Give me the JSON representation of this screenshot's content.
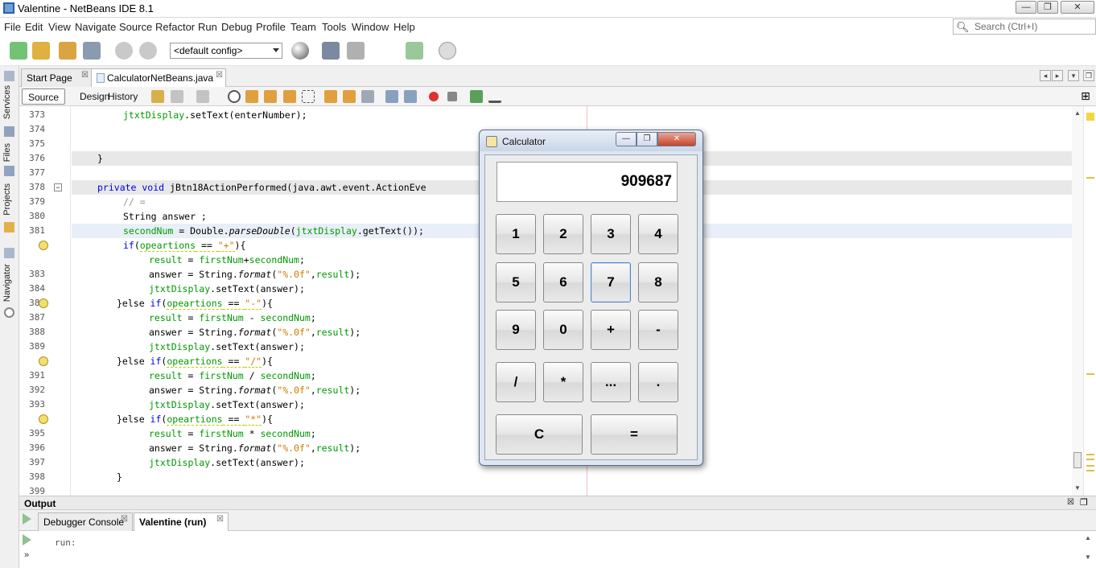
{
  "window": {
    "title": "Valentine - NetBeans IDE 8.1",
    "controls": [
      "—",
      "❐",
      "✕"
    ]
  },
  "menu": [
    "File",
    "Edit",
    "View",
    "Navigate",
    "Source",
    "Refactor",
    "Run",
    "Debug",
    "Profile",
    "Team",
    "Tools",
    "Window",
    "Help"
  ],
  "search": {
    "placeholder": "Search (Ctrl+I)"
  },
  "toolbar": {
    "config": "<default config>"
  },
  "side_tabs": [
    "Services",
    "Files",
    "Projects",
    "Navigator"
  ],
  "editor_tabs": [
    {
      "label": "Start Page"
    },
    {
      "label": "CalculatorNetBeans.java"
    }
  ],
  "editor_toolbar": {
    "source": "Source",
    "design": "Design",
    "history": "History"
  },
  "gutter": {
    "lines": [
      "373",
      "374",
      "375",
      "376",
      "377",
      "378",
      "379",
      "380",
      "381",
      "",
      "383",
      "384",
      "385",
      "",
      "387",
      "388",
      "389",
      "",
      "391",
      "392",
      "393",
      "",
      "395",
      "396",
      "397",
      "398",
      "399"
    ]
  },
  "code": {
    "l373": "jtxtDisplay",
    "l373b": ".setText(enterNumber);",
    "l376": "}",
    "l378a": "private void",
    "l378b": " jBtn18ActionPerformed(java.awt.event.ActionEve",
    "l379": "// =",
    "l380": "String answer ;",
    "l381a": "secondNum",
    "l381b": " = Double.",
    "l381c": "parseDouble",
    "l381d": "(",
    "l381e": "jtxtDisplay",
    "l381f": ".getText());",
    "l382a": "if",
    "l382b": "(",
    "l382c": "opeartions",
    "l382d": " == ",
    "l382e": "\"+\"",
    "l382f": "){",
    "l383a": "result",
    "l383b": " = ",
    "l383c": "firstNum",
    "l383d": "+",
    "l383e": "secondNum",
    "l383f": ";",
    "l384a": "answer = String.",
    "l384b": "format",
    "l384c": "(",
    "l384d": "\"%.0f\"",
    "l384e": ",",
    "l384f": "result",
    "l384g": ");",
    "l385a": "jtxtDisplay",
    "l385b": ".setText(answer);",
    "l386a": "}else ",
    "l386b": "if",
    "l386c": "(",
    "l386d": "opeartions",
    "l386e": " == ",
    "l386f": "\"-\"",
    "l386g": "){",
    "l387a": "result",
    "l387b": " = ",
    "l387c": "firstNum",
    "l387d": " - ",
    "l387e": "secondNum",
    "l387f": ";",
    "l388a": "answer = String.",
    "l388b": "format",
    "l388c": "(",
    "l388d": "\"%.0f\"",
    "l388e": ",",
    "l388f": "result",
    "l388g": ");",
    "l389a": "jtxtDisplay",
    "l389b": ".setText(answer);",
    "l390a": "}else ",
    "l390b": "if",
    "l390c": "(",
    "l390d": "opeartions",
    "l390e": " == ",
    "l390f": "\"/\"",
    "l390g": "){",
    "l391a": "result",
    "l391b": " = ",
    "l391c": "firstNum",
    "l391d": " / ",
    "l391e": "secondNum",
    "l391f": ";",
    "l392a": "answer = String.",
    "l392b": "format",
    "l392c": "(",
    "l392d": "\"%.0f\"",
    "l392e": ",",
    "l392f": "result",
    "l392g": ");",
    "l393a": "jtxtDisplay",
    "l393b": ".setText(answer);",
    "l394a": "}else ",
    "l394b": "if",
    "l394c": "(",
    "l394d": "opeartions",
    "l394e": " == ",
    "l394f": "\"*\"",
    "l394g": "){",
    "l395a": "result",
    "l395b": " = ",
    "l395c": "firstNum",
    "l395d": " * ",
    "l395e": "secondNum",
    "l395f": ";",
    "l396a": "answer = String.",
    "l396b": "format",
    "l396c": "(",
    "l396d": "\"%.0f\"",
    "l396e": ",",
    "l396f": "result",
    "l396g": ");",
    "l397a": "jtxtDisplay",
    "l397b": ".setText(answer);",
    "l398": "}"
  },
  "output": {
    "title": "Output",
    "tabs": [
      {
        "label": "Debugger Console"
      },
      {
        "label": "Valentine (run)"
      }
    ],
    "text": "run:"
  },
  "calculator": {
    "title": "Calculator",
    "display": "909687",
    "buttons": [
      "1",
      "2",
      "3",
      "4",
      "5",
      "6",
      "7",
      "8",
      "9",
      "0",
      "+",
      "-",
      "/",
      "*",
      "...",
      "."
    ],
    "clear": "C",
    "equals": "="
  }
}
